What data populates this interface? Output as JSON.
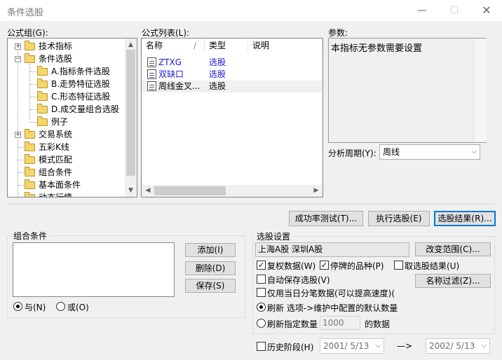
{
  "window": {
    "title": "条件选股",
    "minimize": "—",
    "maximize": "☐",
    "close": "✕"
  },
  "formula_group": {
    "label": "公式组(G):",
    "items": [
      {
        "label": "技术指标",
        "expander": "+"
      },
      {
        "label": "条件选股",
        "expander": "−"
      },
      {
        "label": "A.指标条件选股"
      },
      {
        "label": "B.走势特征选股"
      },
      {
        "label": "C.形态特征选股"
      },
      {
        "label": "D.成交量组合选股"
      },
      {
        "label": "例子"
      },
      {
        "label": "交易系统",
        "expander": "+"
      },
      {
        "label": "五彩K线"
      },
      {
        "label": "模式匹配"
      },
      {
        "label": "组合条件"
      },
      {
        "label": "基本面条件"
      },
      {
        "label": "动态行情"
      }
    ]
  },
  "formula_list": {
    "label": "公式列表(L):",
    "columns": [
      "名称",
      "类型",
      "说明"
    ],
    "sort_mark": "/",
    "rows": [
      {
        "name": "ZTXG",
        "type": "选股",
        "desc": ""
      },
      {
        "name": "双缺口",
        "type": "选股",
        "desc": ""
      },
      {
        "name": "周线金叉...",
        "type": "选股",
        "desc": ""
      }
    ]
  },
  "params": {
    "label": "参数:",
    "text": "本指标无参数需要设置"
  },
  "period": {
    "label": "分析周期(Y):",
    "value": "周线"
  },
  "buttons": {
    "success_test": "成功率测试(T)...",
    "execute": "执行选股(E)",
    "result": "选股结果(R)...",
    "add": "添加(I)",
    "delete": "删除(D)",
    "save": "保存(S)",
    "change_range": "改变范围(C)...",
    "name_filter": "名称过滤(Z)..."
  },
  "combo_conditions": {
    "title": "组合条件",
    "and_label": "与(N)",
    "or_label": "或(O)"
  },
  "selection_settings": {
    "title": "选股设置",
    "range_text": "上海A股   深圳A股",
    "restore_rights": "复权数据(W)",
    "suspended": "停牌的品种(P)",
    "cancel_result": "取选股结果(U)",
    "auto_save": "自动保存选股(V)",
    "today_tick": "仅用当日分笔数据(可以提高速度)(",
    "refresh_default": "刷新 选项->维护中配置的默认数量",
    "refresh_count_label": "刷新指定数量",
    "refresh_count_value": "1000",
    "refresh_count_suffix": "的数据",
    "history_label": "历史阶段(H)",
    "date_from": "2001/ 5/13",
    "date_arrow": "—>",
    "date_to": "2002/ 5/13"
  }
}
